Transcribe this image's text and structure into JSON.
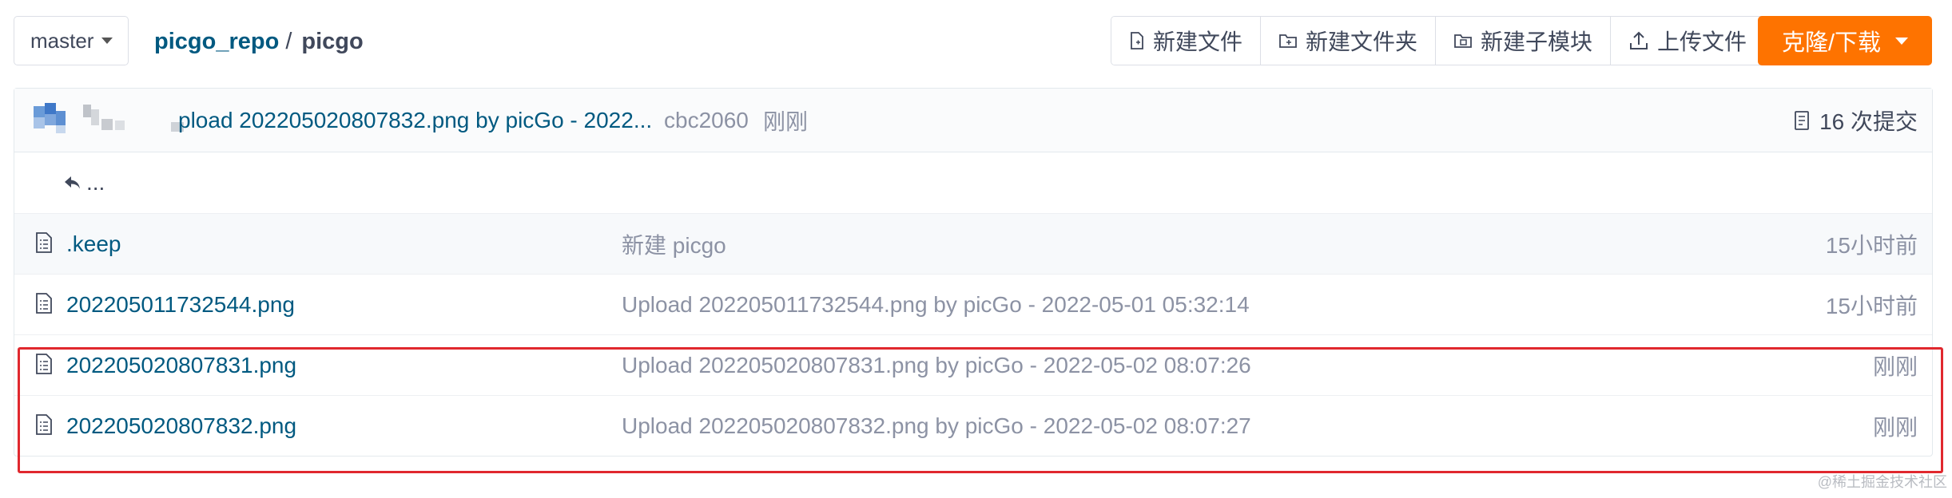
{
  "toolbar": {
    "branch": "master",
    "breadcrumb_repo": "picgo_repo",
    "breadcrumb_sep": "/",
    "breadcrumb_current": "picgo",
    "new_file": "新建文件",
    "new_folder": "新建文件夹",
    "new_submodule": "新建子模块",
    "upload_file": "上传文件",
    "clone_download": "克隆/下载"
  },
  "commit": {
    "message": "pload 202205020807832.png by picGo - 2022...",
    "sha": "cbc2060",
    "time": "刚刚",
    "count": "16 次提交"
  },
  "parent_dir": "...",
  "files": [
    {
      "name": ".keep",
      "message": "新建 picgo",
      "time": "15小时前"
    },
    {
      "name": "202205011732544.png",
      "message": "Upload 202205011732544.png by picGo - 2022-05-01 05:32:14",
      "time": "15小时前"
    },
    {
      "name": "202205020807831.png",
      "message": "Upload 202205020807831.png by picGo - 2022-05-02 08:07:26",
      "time": "刚刚"
    },
    {
      "name": "202205020807832.png",
      "message": "Upload 202205020807832.png by picGo - 2022-05-02 08:07:27",
      "time": "刚刚"
    }
  ],
  "watermark": "@稀土掘金技术社区",
  "colors": {
    "link": "#005980",
    "muted": "#8c92a4",
    "clone_button": "#fe7300",
    "annotation": "#e0282e"
  }
}
